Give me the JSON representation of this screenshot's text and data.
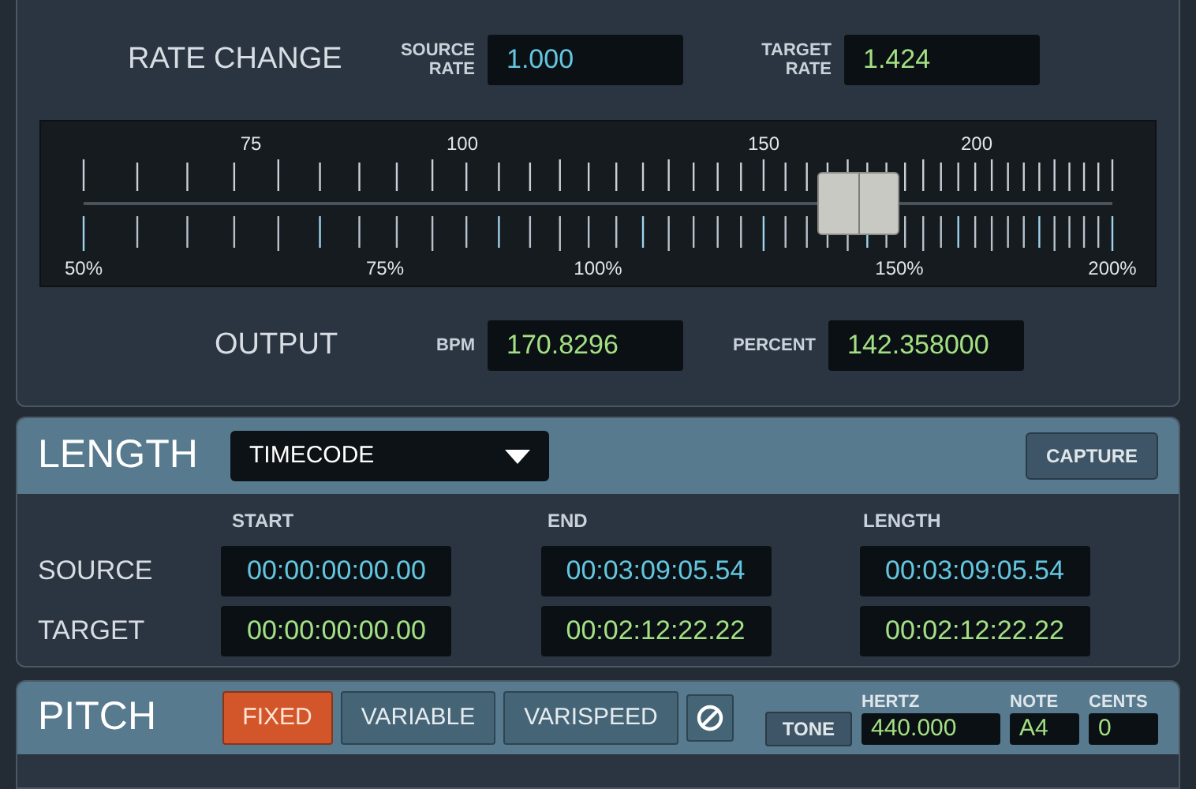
{
  "rate_change": {
    "title": "RATE CHANGE",
    "fields": [
      {
        "label": "SOURCE RATE",
        "value": "1.000",
        "kind": "source"
      },
      {
        "label": "TARGET RATE",
        "value": "1.424",
        "kind": "target"
      }
    ],
    "slider": {
      "bpm_labels": [
        "75",
        "100",
        "150",
        "200"
      ],
      "percent_labels": [
        "50%",
        "75%",
        "100%",
        "150%",
        "200%"
      ],
      "level": 0.753
    },
    "output": {
      "title": "OUTPUT",
      "fields": [
        {
          "label": "BPM",
          "value": "170.8296",
          "kind": "target"
        },
        {
          "label": "PERCENT",
          "value": "142.358000",
          "kind": "target"
        }
      ]
    }
  },
  "length": {
    "title": "LENGTH",
    "dropdown": "TIMECODE",
    "capture": "CAPTURE",
    "columns": [
      "START",
      "END",
      "LENGTH"
    ],
    "rows": [
      {
        "label": "SOURCE",
        "kind": "source",
        "values": [
          "00:00:00:00.00",
          "00:03:09:05.54",
          "00:03:09:05.54"
        ]
      },
      {
        "label": "TARGET",
        "kind": "target",
        "values": [
          "00:00:00:00.00",
          "00:02:12:22.22",
          "00:02:12:22.22"
        ]
      }
    ]
  },
  "pitch": {
    "title": "PITCH",
    "modes": [
      {
        "label": "FIXED",
        "selected": true
      },
      {
        "label": "VARIABLE",
        "selected": false
      },
      {
        "label": "VARISPEED",
        "selected": false
      }
    ],
    "tone": "TONE",
    "fields": [
      {
        "label": "HERTZ",
        "value": "440.000"
      },
      {
        "label": "NOTE",
        "value": "A4"
      },
      {
        "label": "CENTS",
        "value": "0"
      }
    ]
  }
}
